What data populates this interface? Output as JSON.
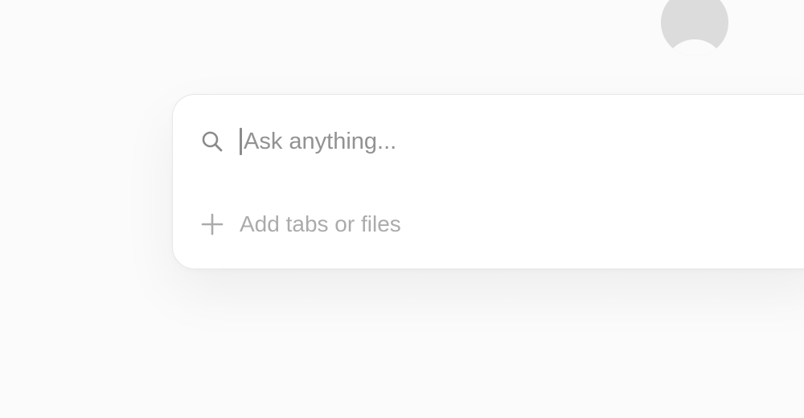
{
  "avatar": {
    "icon": "avatar-icon",
    "color": "#dcdcdc"
  },
  "search": {
    "icon": "search-icon",
    "placeholder": "Ask anything...",
    "value": ""
  },
  "attachments": {
    "icon": "plus-icon",
    "label": "Add tabs or files"
  },
  "colors": {
    "background": "#fbfbfb",
    "card": "#ffffff",
    "placeholder": "#929292",
    "secondary_text": "#ababab"
  }
}
